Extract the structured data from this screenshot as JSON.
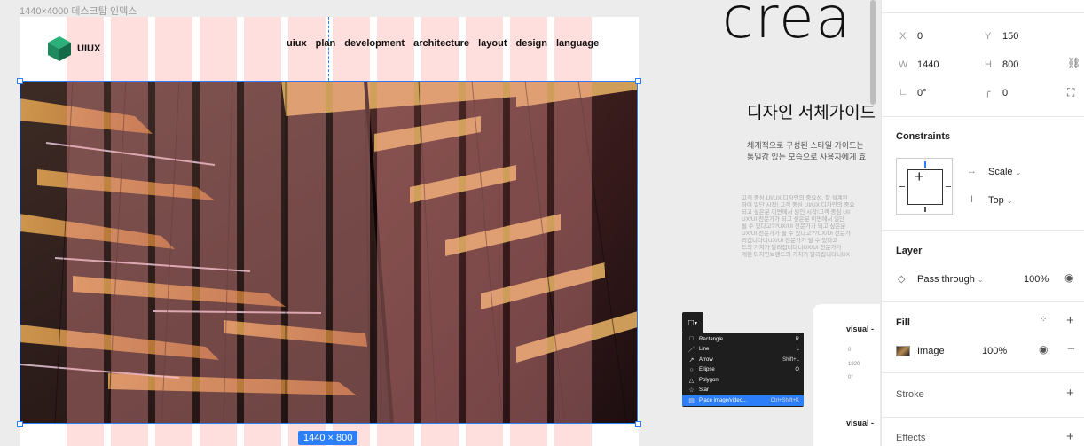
{
  "frame": {
    "label": "1440×4000 데스크탑 인덱스",
    "logo_text": "UIUX",
    "nav": [
      "uiux",
      "plan",
      "development",
      "architecture",
      "layout",
      "design",
      "language"
    ],
    "size_badge": "1440 × 800"
  },
  "preview": {
    "headline": "crea",
    "guide_title": "디자인 서체가이드",
    "guide_line1": "체계적으로 구성된 스타일 가이드는",
    "guide_line2": "통일감 있는 모습으로 사용자에게 효",
    "guide_body": "고객 중심 UI/UX 디자인의 중요성, 잘 설계된\n하여 일단 시작! 고객 중심 UI/UX 디자인의 중요\n되고 싶은분 이면에서 원인 시작!고객 중심 UI/\nUX/UI 전문가가 되고 싶은분 이면에서 일단\n될 수 있다고??UX/UI 전문가가 되고 싶은분\nUX/UI 전문가가 될 수 있다고??UX/UI 전문가\n리겁니다니UX/UI 전문가가 될 수 있다고\n드의 가치가 달라집니다니UX/UI 전문가가\n게된 디자인브랜드의 가치가 달라집니다니UX",
    "card1_title": "visual -",
    "card1_x": "0",
    "card1_w": "1920",
    "card1_rot": "0°",
    "card2_title": "visual -"
  },
  "shape_menu": {
    "items": [
      {
        "icon": "rectangle-icon",
        "glyph": "□",
        "label": "Rectangle",
        "shortcut": "R"
      },
      {
        "icon": "line-icon",
        "glyph": "／",
        "label": "Line",
        "shortcut": "L"
      },
      {
        "icon": "arrow-icon",
        "glyph": "↗",
        "label": "Arrow",
        "shortcut": "Shift+L"
      },
      {
        "icon": "ellipse-icon",
        "glyph": "○",
        "label": "Ellipse",
        "shortcut": "O"
      },
      {
        "icon": "polygon-icon",
        "glyph": "△",
        "label": "Polygon",
        "shortcut": ""
      },
      {
        "icon": "star-icon",
        "glyph": "☆",
        "label": "Star",
        "shortcut": ""
      },
      {
        "icon": "image-icon",
        "glyph": "▨",
        "label": "Place image/video...",
        "shortcut": "Ctrl+Shift+K",
        "active": true
      }
    ]
  },
  "inspector": {
    "x_label": "X",
    "x_value": "0",
    "y_label": "Y",
    "y_value": "150",
    "w_label": "W",
    "w_value": "1440",
    "h_label": "H",
    "h_value": "800",
    "rotation": "0°",
    "radius": "0",
    "constraints_title": "Constraints",
    "constraint_h": "Scale",
    "constraint_v": "Top",
    "layer_title": "Layer",
    "blend_mode": "Pass through",
    "layer_opacity": "100%",
    "fill_title": "Fill",
    "fill_type": "Image",
    "fill_opacity": "100%",
    "stroke_title": "Stroke",
    "effects_title": "Effects"
  },
  "colors": {
    "selection": "#2d7ff9",
    "grid_column": "#ffd6d6",
    "menu_bg": "#1e1e1e",
    "logo": "#1f8a5e"
  }
}
